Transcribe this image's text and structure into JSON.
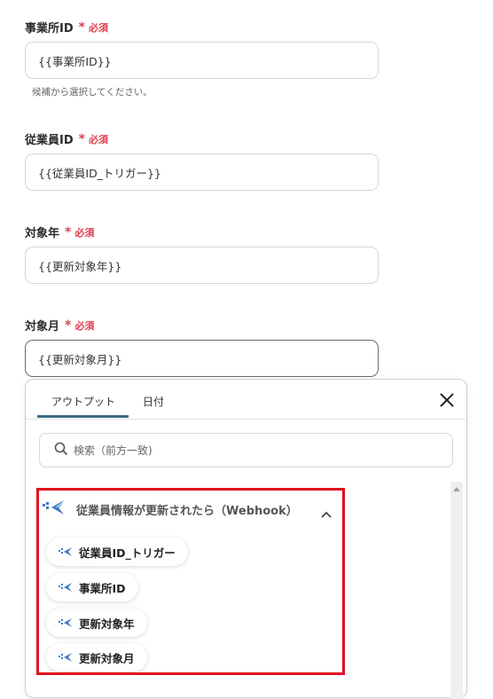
{
  "required_mark": "*",
  "required_text": "必須",
  "fields": [
    {
      "label": "事業所ID",
      "value": "{{事業所ID}}",
      "hint": "候補から選択してください。"
    },
    {
      "label": "従業員ID",
      "value": "{{従業員ID_トリガー}}"
    },
    {
      "label": "対象年",
      "value": "{{更新対象年}}"
    },
    {
      "label": "対象月",
      "value": "{{更新対象月}}"
    }
  ],
  "panel": {
    "tabs": [
      {
        "label": "アウトプット",
        "active": true
      },
      {
        "label": "日付",
        "active": false
      }
    ],
    "search_placeholder": "検索（前方一致)",
    "group": {
      "title": "従業員情報が更新されたら（Webhook）",
      "expanded": true,
      "items": [
        "従業員ID_トリガー",
        "事業所ID",
        "更新対象年",
        "更新対象月"
      ]
    }
  },
  "colors": {
    "required": "#e03e52",
    "highlight_border": "#e01020",
    "tab_underline": "#3a6c86",
    "webhook_icon": "#3f78c4"
  },
  "icons": {
    "close": "close-icon",
    "search": "search-icon",
    "webhook": "webhook-icon",
    "chevron": "chevron-up-icon"
  }
}
